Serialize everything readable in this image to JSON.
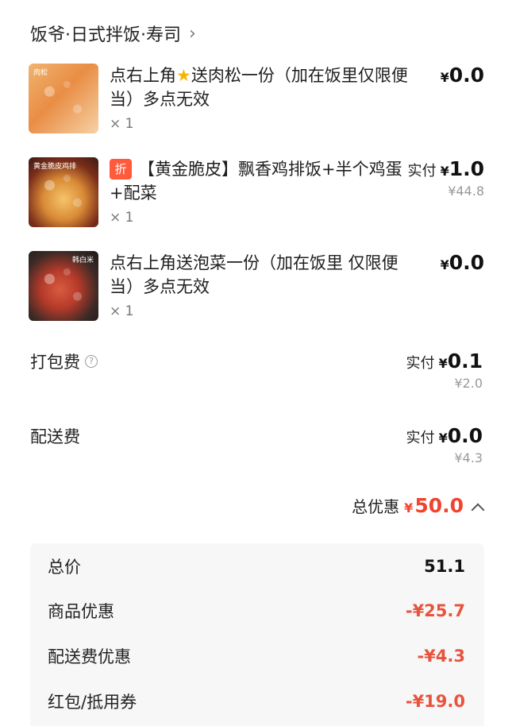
{
  "store": {
    "name": "饭爷·日式拌饭·寿司",
    "chevron": "›"
  },
  "items": [
    {
      "title_before_icon": "点右上角",
      "icon": "star-icon",
      "title_after_icon": "送肉松一份（加在饭里仅限便当）多点无效",
      "qty": "× 1",
      "currency": "¥",
      "price": "0.0",
      "image_tag": "肉松"
    },
    {
      "badge": "折",
      "title": "【黄金脆皮】飘香鸡排饭+半个鸡蛋+配菜",
      "qty": "× 1",
      "pay_prefix": "实付",
      "currency": "¥",
      "price": "1.0",
      "original_price": "¥44.8",
      "image_tag": "黄金脆皮鸡排"
    },
    {
      "title": "点右上角送泡菜一份（加在饭里 仅限便当）多点无效",
      "qty": "× 1",
      "currency": "¥",
      "price": "0.0",
      "image_tag": "韩白米"
    }
  ],
  "packaging": {
    "label": "打包费",
    "help_icon": "?",
    "pay_prefix": "实付",
    "currency": "¥",
    "price": "0.1",
    "original_price": "¥2.0"
  },
  "delivery": {
    "label": "配送费",
    "pay_prefix": "实付",
    "currency": "¥",
    "price": "0.0",
    "original_price": "¥4.3"
  },
  "total_discount": {
    "label": "总优惠",
    "currency": "¥",
    "amount": "50.0"
  },
  "breakdown": [
    {
      "label": "总价",
      "value": "51.1"
    },
    {
      "label": "商品优惠",
      "value": "-¥25.7"
    },
    {
      "label": "配送费优惠",
      "value": "-¥4.3"
    },
    {
      "label": "红包/抵用券",
      "value": "-¥19.0"
    }
  ],
  "colors": {
    "accent_red": "#f0442f",
    "discount_red": "#e8533d",
    "badge_bg": "#ff5a3c",
    "star": "#f7b500"
  }
}
